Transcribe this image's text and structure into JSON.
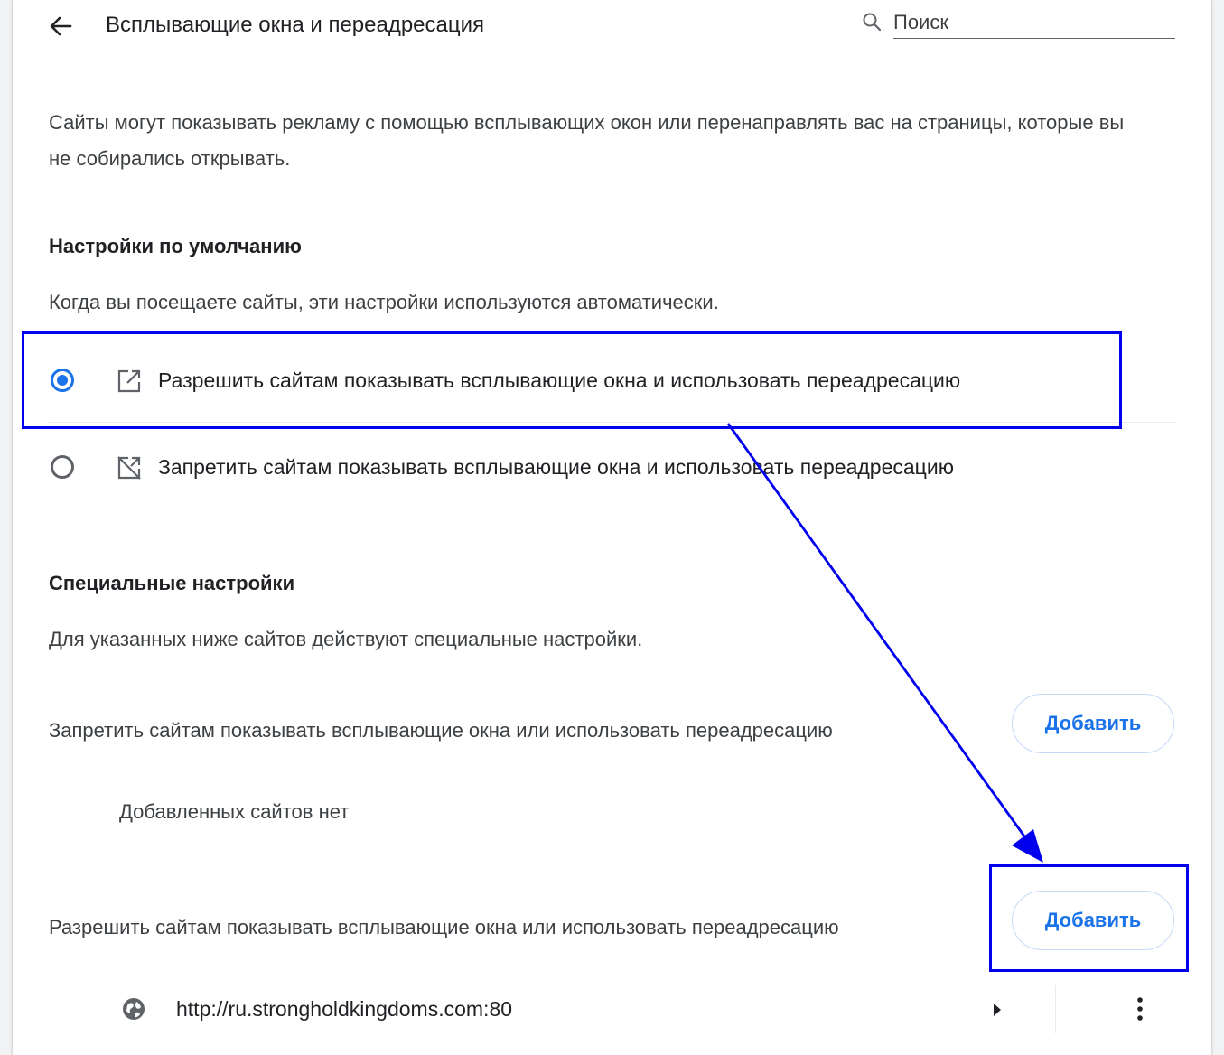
{
  "header": {
    "back_icon": "arrow-left-icon",
    "title": "Всплывающие окна и переадресация",
    "search_icon": "search-icon",
    "search_placeholder": "Поиск"
  },
  "description": "Сайты могут показывать рекламу с помощью всплывающих окон или перенаправлять вас на страницы, которые вы не собирались открывать.",
  "default_settings": {
    "title": "Настройки по умолчанию",
    "subtitle": "Когда вы посещаете сайты, эти настройки используются автоматически.",
    "options": [
      {
        "label": "Разрешить сайтам показывать всплывающие окна и использовать переадресацию",
        "icon": "open-in-new-icon",
        "selected": true
      },
      {
        "label": "Запретить сайтам показывать всплывающие окна и использовать переадресацию",
        "icon": "open-in-new-off-icon",
        "selected": false
      }
    ]
  },
  "custom_settings": {
    "title": "Специальные настройки",
    "subtitle": "Для указанных ниже сайтов действуют специальные настройки.",
    "block": {
      "label": "Запретить сайтам показывать всплывающие окна или использовать переадресацию",
      "add_label": "Добавить",
      "empty_text": "Добавленных сайтов нет"
    },
    "allow": {
      "label": "Разрешить сайтам показывать всплывающие окна или использовать переадресацию",
      "add_label": "Добавить",
      "sites": [
        {
          "url": "http://ru.strongholdkingdoms.com:80",
          "icon": "globe-icon"
        }
      ]
    }
  },
  "annotation_color": "#0000ee",
  "accent_color": "#1a73e8"
}
